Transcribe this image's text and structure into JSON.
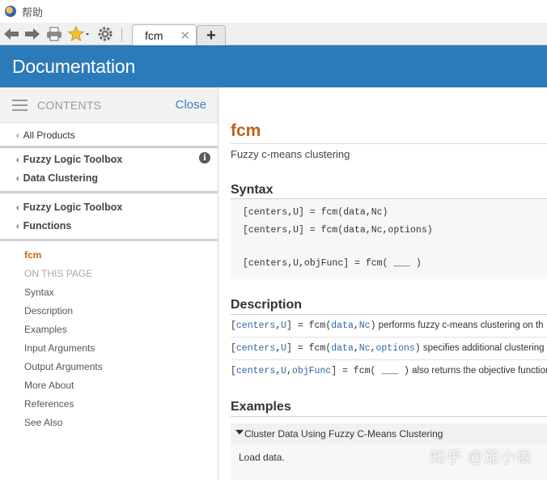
{
  "window": {
    "title": "帮助"
  },
  "toolbar": {
    "tab_label": "fcm",
    "tab_close": "✕",
    "new_tab": "+"
  },
  "header": {
    "title": "Documentation"
  },
  "sidebar": {
    "contents_label": "CONTENTS",
    "close_label": "Close",
    "all_products": "All Products",
    "breadcrumb_1": {
      "product": "Fuzzy Logic Toolbox",
      "section": "Data Clustering"
    },
    "breadcrumb_2": {
      "product": "Fuzzy Logic Toolbox",
      "section": "Functions"
    },
    "current_page": "fcm",
    "on_this_page": "ON THIS PAGE",
    "toc": [
      "Syntax",
      "Description",
      "Examples",
      "Input Arguments",
      "Output Arguments",
      "More About",
      "References",
      "See Also"
    ]
  },
  "main": {
    "title": "fcm",
    "purpose": "Fuzzy c-means clustering",
    "syntax_heading": "Syntax",
    "syntax": [
      "[centers,U] = fcm(data,Nc)",
      "[centers,U] = fcm(data,Nc,options)",
      "[centers,U,objFunc] = fcm( ___ )"
    ],
    "description_heading": "Description",
    "description": [
      {
        "open": "[",
        "a1": "centers",
        "comma1": ",",
        "a2": "U",
        "mid": "] = fcm(",
        "a3": "data",
        "comma2": ",",
        "a4": "Nc",
        "close": ")",
        "text": " performs fuzzy c-means clustering on th"
      },
      {
        "open": "[",
        "a1": "centers",
        "comma1": ",",
        "a2": "U",
        "mid": "] = fcm(",
        "a3": "data",
        "comma2": ",",
        "a4": "Nc",
        "comma3": ",",
        "a5": "options",
        "close": ")",
        "text": " specifies additional clustering"
      },
      {
        "open": "[",
        "a1": "centers",
        "comma1": ",",
        "a2": "U",
        "comma2": ",",
        "a3": "objFunc",
        "close": "] = fcm( ___ )",
        "text": " also returns the objective function v"
      }
    ],
    "examples_heading": "Examples",
    "example_title": "Cluster Data Using Fuzzy C-Means Clustering",
    "example_body": "Load data."
  },
  "watermark": "知乎 @茄小依",
  "colors": {
    "header_bg": "#2b7ab9",
    "title_accent": "#c0631a",
    "link": "#3c7fbf",
    "code_arg": "#2f67a5"
  }
}
